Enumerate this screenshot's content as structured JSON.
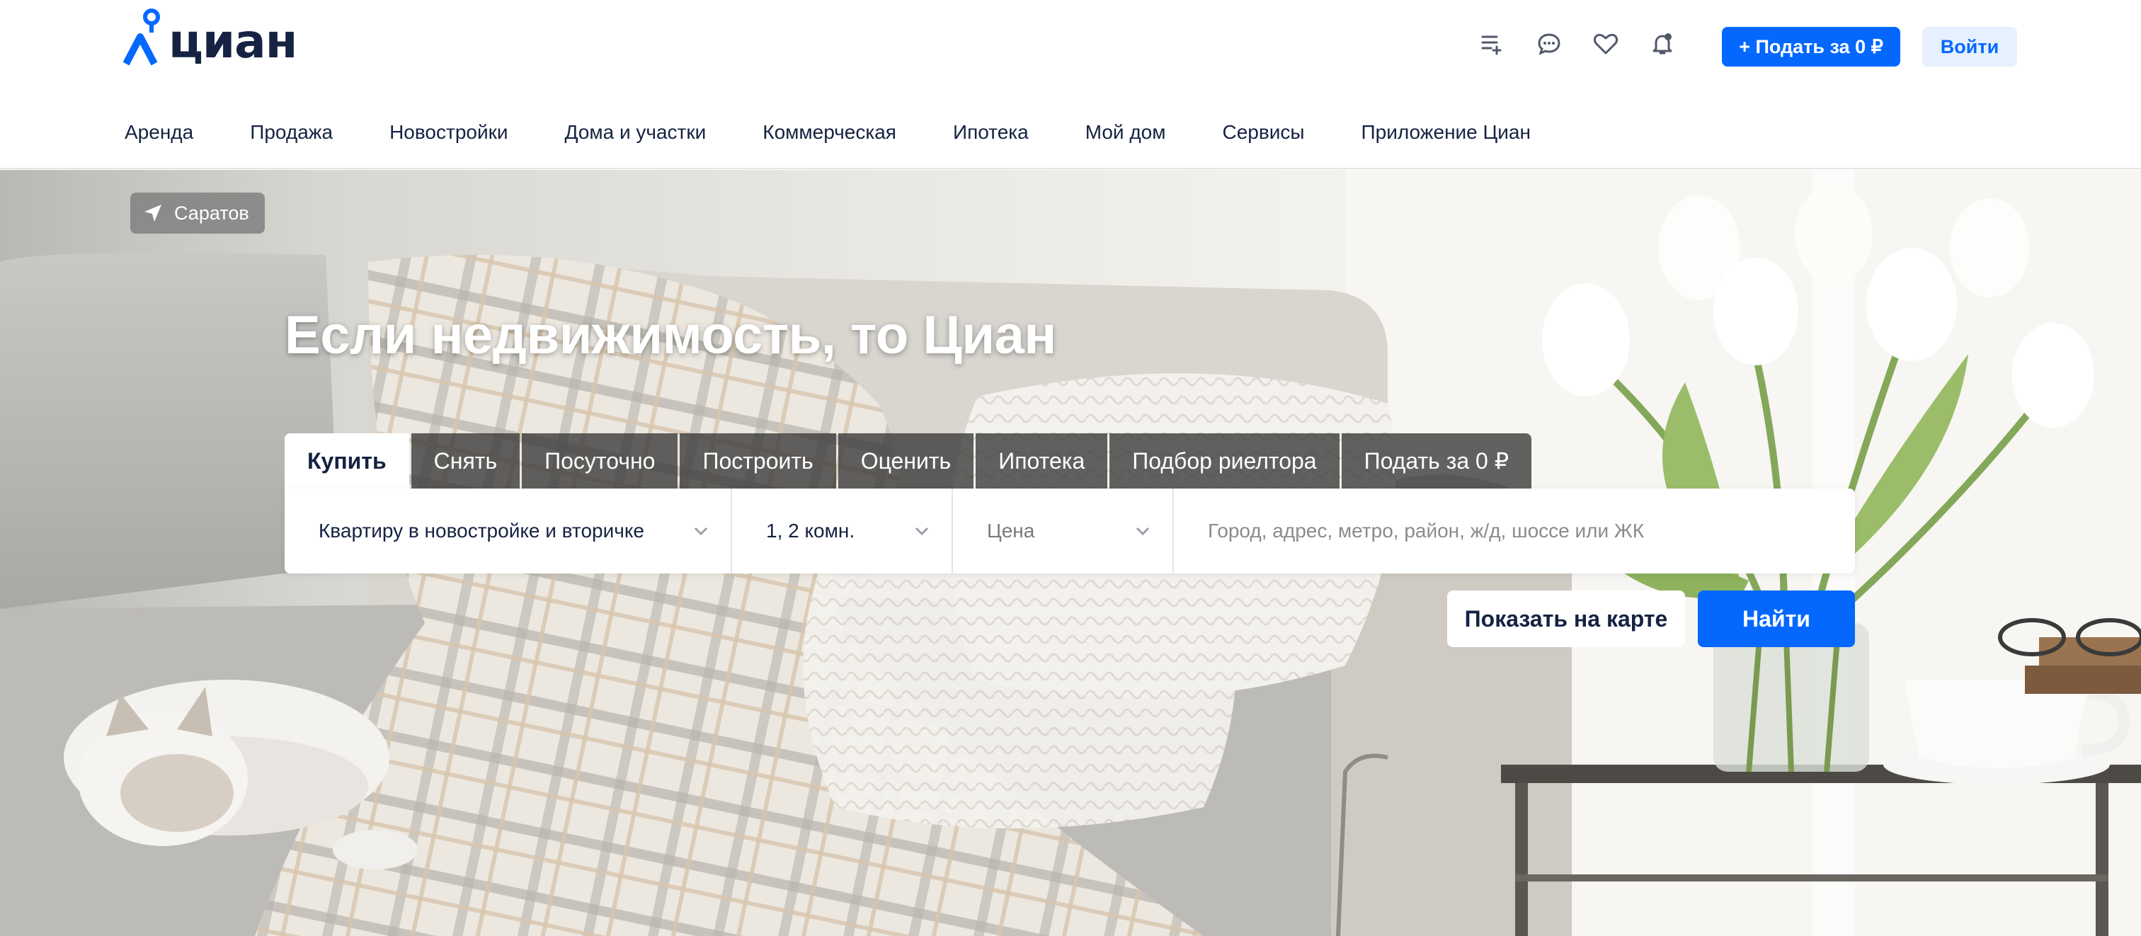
{
  "brand": {
    "name": "циан",
    "accent": "#0468ff",
    "text_color": "#152242"
  },
  "header": {
    "icons": [
      "compare-list-icon",
      "chat-icon",
      "heart-icon",
      "bell-icon"
    ],
    "post_button": "+ Подать за 0 ₽",
    "login_button": "Войти"
  },
  "nav": {
    "items": [
      {
        "label": "Аренда"
      },
      {
        "label": "Продажа"
      },
      {
        "label": "Новостройки"
      },
      {
        "label": "Дома и участки"
      },
      {
        "label": "Коммерческая"
      },
      {
        "label": "Ипотека"
      },
      {
        "label": "Мой дом"
      },
      {
        "label": "Сервисы"
      },
      {
        "label": "Приложение Циан"
      }
    ]
  },
  "hero": {
    "city": "Саратов",
    "title": "Если недвижимость, то Циан",
    "tabs": [
      {
        "label": "Купить",
        "active": true
      },
      {
        "label": "Снять"
      },
      {
        "label": "Посуточно"
      },
      {
        "label": "Построить"
      },
      {
        "label": "Оценить"
      },
      {
        "label": "Ипотека"
      },
      {
        "label": "Подбор риелтора"
      },
      {
        "label": "Подать за 0 ₽"
      }
    ],
    "search": {
      "property_type": "Квартиру в новостройке и вторичке",
      "rooms": "1, 2 комн.",
      "price": "Цена",
      "location_placeholder": "Город, адрес, метро, район, ж/д, шоссе или ЖК"
    },
    "map_button": "Показать на карте",
    "find_button": "Найти"
  }
}
